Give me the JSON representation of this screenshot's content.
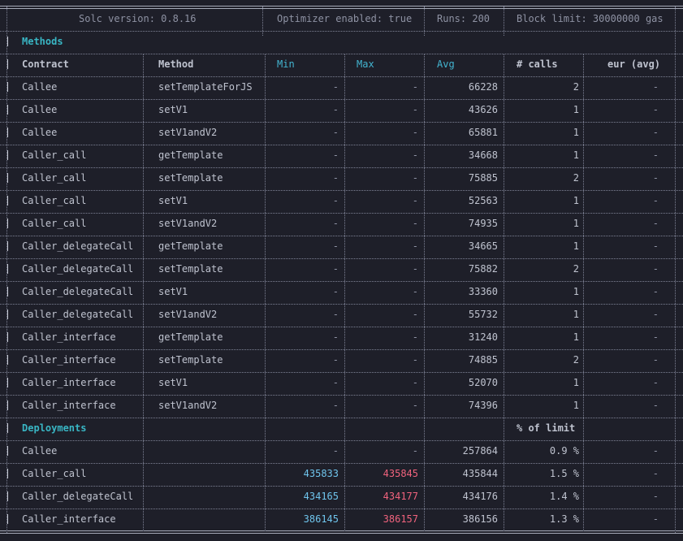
{
  "header": {
    "solc_version": "Solc version: 0.8.16",
    "optimizer": "Optimizer enabled: true",
    "runs": "Runs: 200",
    "block_limit": "Block limit: 30000000 gas"
  },
  "methods_section": {
    "title": "Methods",
    "columns": [
      "Contract",
      "Method",
      "Min",
      "Max",
      "Avg",
      "# calls",
      "eur (avg)"
    ],
    "rows": [
      [
        "Callee",
        "setTemplateForJS",
        "-",
        "-",
        "66228",
        "2",
        "-"
      ],
      [
        "Callee",
        "setV1",
        "-",
        "-",
        "43626",
        "1",
        "-"
      ],
      [
        "Callee",
        "setV1andV2",
        "-",
        "-",
        "65881",
        "1",
        "-"
      ],
      [
        "Caller_call",
        "getTemplate",
        "-",
        "-",
        "34668",
        "1",
        "-"
      ],
      [
        "Caller_call",
        "setTemplate",
        "-",
        "-",
        "75885",
        "2",
        "-"
      ],
      [
        "Caller_call",
        "setV1",
        "-",
        "-",
        "52563",
        "1",
        "-"
      ],
      [
        "Caller_call",
        "setV1andV2",
        "-",
        "-",
        "74935",
        "1",
        "-"
      ],
      [
        "Caller_delegateCall",
        "getTemplate",
        "-",
        "-",
        "34665",
        "1",
        "-"
      ],
      [
        "Caller_delegateCall",
        "setTemplate",
        "-",
        "-",
        "75882",
        "2",
        "-"
      ],
      [
        "Caller_delegateCall",
        "setV1",
        "-",
        "-",
        "33360",
        "1",
        "-"
      ],
      [
        "Caller_delegateCall",
        "setV1andV2",
        "-",
        "-",
        "55732",
        "1",
        "-"
      ],
      [
        "Caller_interface",
        "getTemplate",
        "-",
        "-",
        "31240",
        "1",
        "-"
      ],
      [
        "Caller_interface",
        "setTemplate",
        "-",
        "-",
        "74885",
        "2",
        "-"
      ],
      [
        "Caller_interface",
        "setV1",
        "-",
        "-",
        "52070",
        "1",
        "-"
      ],
      [
        "Caller_interface",
        "setV1andV2",
        "-",
        "-",
        "74396",
        "1",
        "-"
      ]
    ]
  },
  "deployments_section": {
    "title": "Deployments",
    "limit_header": "% of limit",
    "rows": [
      [
        "Callee",
        "-",
        "-",
        "257864",
        "0.9 %",
        "-"
      ],
      [
        "Caller_call",
        "435833",
        "435845",
        "435844",
        "1.5 %",
        "-"
      ],
      [
        "Caller_delegateCall",
        "434165",
        "434177",
        "434176",
        "1.4 %",
        "-"
      ],
      [
        "Caller_interface",
        "386145",
        "386157",
        "386156",
        "1.3 %",
        "-"
      ]
    ]
  },
  "colors": {
    "background": "#1e1f29",
    "text": "#bfc3cf",
    "dim": "#8e92a3",
    "section_title": "#39b6c4",
    "column_min_max": "#43b4d0",
    "min_value": "#6fc4ec",
    "max_value": "#f0637d",
    "border": "#7d8194"
  }
}
